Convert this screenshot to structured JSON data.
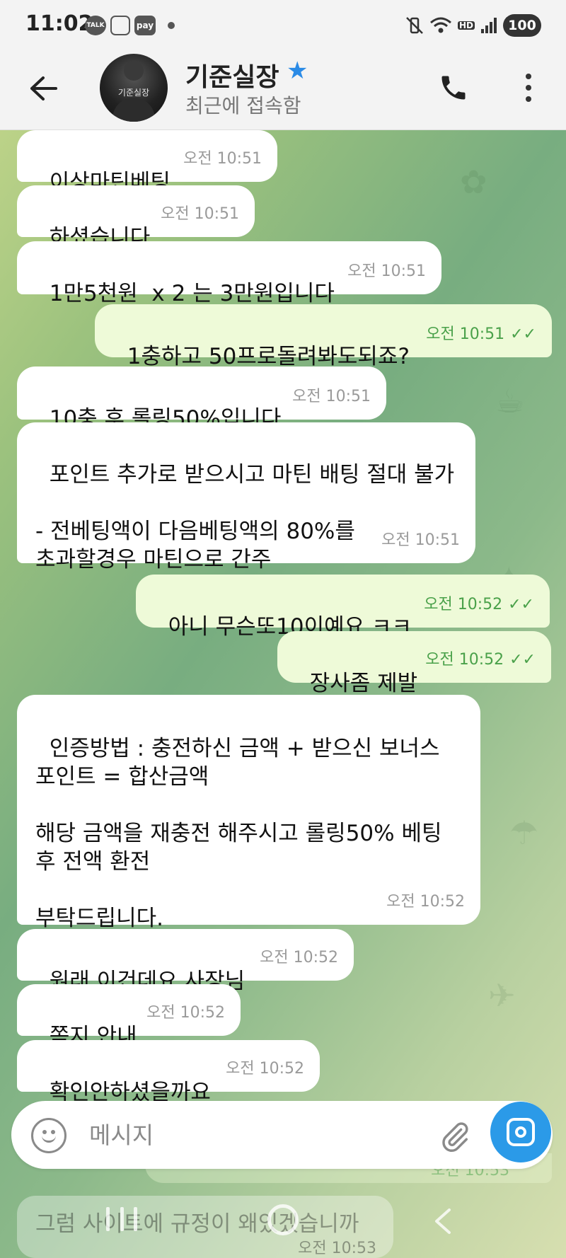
{
  "status_bar": {
    "time": "11:02",
    "notif_icons": [
      {
        "name": "talk-notification-icon",
        "label": "TALK"
      },
      {
        "name": "screenshot-notification-icon",
        "label": ""
      },
      {
        "name": "pay-notification-icon",
        "label": "pay"
      }
    ],
    "right_icons": [
      "mute-vibrate-icon",
      "wifi-icon",
      "hd-voice-icon",
      "signal-icon"
    ],
    "hd_label": "HD",
    "battery": "100"
  },
  "header": {
    "contact_name": "기준실장",
    "last_seen": "최근에 접속함",
    "avatar_text": "기준실장",
    "star_icon": "star-icon",
    "call_icon": "phone-icon",
    "menu_icon": "more-vert-icon"
  },
  "messages": [
    {
      "dir": "in",
      "text": "이상마틴베팅",
      "time": "오전 10:51"
    },
    {
      "dir": "in",
      "text": "하셨습니다",
      "time": "오전 10:51"
    },
    {
      "dir": "in",
      "text": "1만5천원  x 2 는 3만원입니다",
      "time": "오전 10:51"
    },
    {
      "dir": "out",
      "text": "1충하고 50프로돌려봐도되죠?",
      "time": "오전 10:51"
    },
    {
      "dir": "in",
      "text": "10충 후 롤링50%입니다",
      "time": "오전 10:51"
    },
    {
      "dir": "in",
      "text": "포인트 추가로 받으시고 마틴 배팅 절대 불가\n\n- 전베팅액이 다음베팅액의 80%를\n초과할경우 마틴으로 간주",
      "time": "오전 10:51"
    },
    {
      "dir": "out",
      "text": "아니 무슨또10이예요 ㅋㅋ",
      "time": "오전 10:52"
    },
    {
      "dir": "out",
      "text": "장사좀 제발",
      "time": "오전 10:52"
    },
    {
      "dir": "in",
      "text": "인증방법 : 충전하신 금액 + 받으신 보너스\n포인트 = 합산금액\n\n해당 금액을 재충전 해주시고 롤링50% 베팅\n후 전액 환전\n\n부탁드립니다.",
      "time": "오전 10:52"
    },
    {
      "dir": "in",
      "text": "원래 이건데요 사장님",
      "time": "오전 10:52"
    },
    {
      "dir": "in",
      "text": "쪽지 안내",
      "time": "오전 10:52"
    },
    {
      "dir": "in",
      "text": "확인안하셨을까요",
      "time": "오전 10:52"
    }
  ],
  "ghost_messages": [
    {
      "text": "그럼 사이트에 규정이 왜있겠습니까",
      "time": "오전 10:53"
    }
  ],
  "ghost_time_out": "오전 10:53",
  "input": {
    "placeholder": "메시지",
    "emoji_icon": "emoji-icon",
    "attach_icon": "paperclip-icon",
    "camera_icon": "camera-icon"
  },
  "colors": {
    "incoming_bubble": "#ffffff",
    "outgoing_bubble": "#eefad8",
    "outgoing_time": "#4aa14a",
    "accent": "#2b9ae8"
  }
}
